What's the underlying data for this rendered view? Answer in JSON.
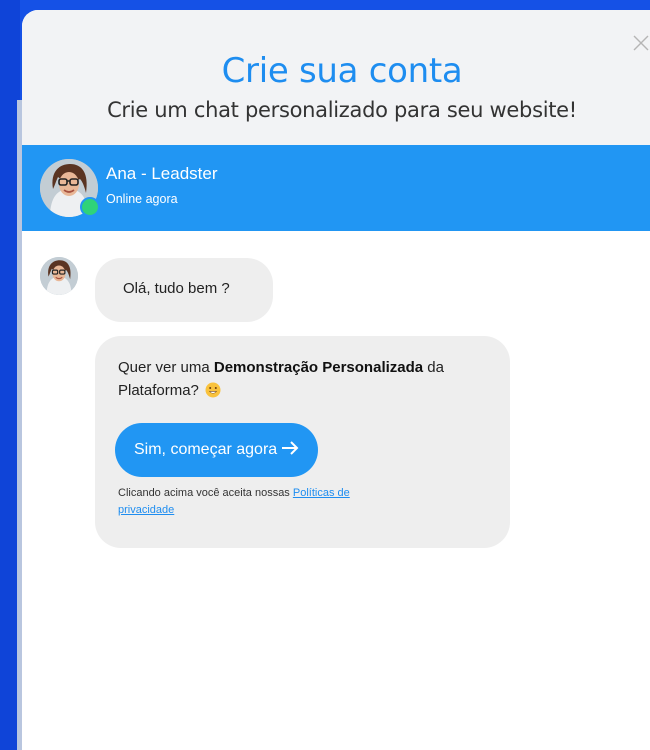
{
  "modal": {
    "title": "Crie sua conta",
    "subtitle": "Crie um chat personalizado para seu website!",
    "close_icon": "close-icon"
  },
  "chat_header": {
    "agent_name": "Ana - Leadster",
    "status": "Online agora",
    "status_color": "#2fd37a",
    "background_color": "#2196f3"
  },
  "messages": [
    {
      "text": "Olá, tudo bem ?"
    },
    {
      "text_before": "Quer ver uma ",
      "text_bold": "Demonstração Personalizada",
      "text_after": " da Plataforma? ",
      "emoji": "grinning-face-emoji",
      "button_label": "Sim, começar agora",
      "button_icon": "arrow-right-icon",
      "consent_text": "Clicando acima você aceita nossas ",
      "consent_link": "Políticas de privacidade"
    }
  ],
  "colors": {
    "accent": "#1e8df0",
    "page_background": "#1551e6",
    "bubble_background": "#eeeeee"
  }
}
